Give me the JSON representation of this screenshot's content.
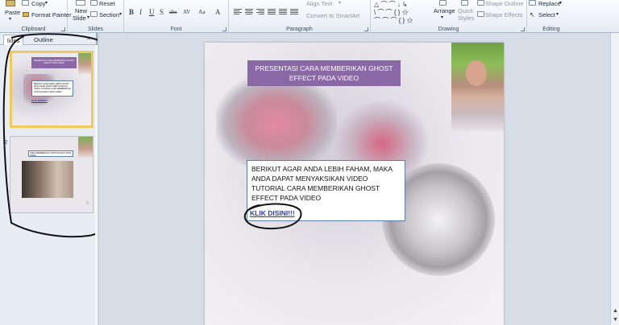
{
  "ribbon": {
    "clipboard": {
      "label": "Clipboard",
      "paste": "Paste",
      "copy": "Copy",
      "format_painter": "Format Painter"
    },
    "slides": {
      "label": "Slides",
      "new_slide_1": "New",
      "new_slide_2": "Slide",
      "reset": "Reset",
      "section": "Section"
    },
    "font": {
      "label": "Font",
      "bold": "B",
      "italic": "I",
      "underline": "U",
      "shadow": "S",
      "strike": "abc",
      "spacing": "AV",
      "case": "Aa",
      "color": "A"
    },
    "paragraph": {
      "label": "Paragraph",
      "align_text": "Align Text",
      "convert_smartart": "Convert to SmartArt"
    },
    "drawing": {
      "label": "Drawing",
      "arrange": "Arrange",
      "quick_styles_1": "Quick",
      "quick_styles_2": "Styles",
      "shape_outline": "Shape Outline",
      "shape_effects": "Shape Effects"
    },
    "editing": {
      "label": "Editing",
      "replace": "Replace",
      "select": "Select"
    }
  },
  "pane": {
    "tabs": [
      {
        "label": "lides"
      },
      {
        "label": "Outline"
      }
    ],
    "thumb1": {
      "title": "PRESENTASI CARA MEMBERIKAN GHOST EFFECT PADA VIDEO",
      "body": "BERIKUT AGAR ANDA LEBIH FAHAM, MAKA ANDA DAPAT MENYAKSIKAN VIDEO TUTORIAL CARA MEMBERIKAN GHOST EFFECT PADA VIDEO",
      "link": "KLIK DISINI!!!"
    },
    "thumb2": {
      "number": "2",
      "title": "CARA MEMBERIKAN GHOST EFFECT PADA VIDEO"
    }
  },
  "slide": {
    "title": "PRESENTASI CARA MEMBERIKAN GHOST EFFECT PADA VIDEO",
    "body": "BERIKUT AGAR ANDA LEBIH FAHAM, MAKA ANDA DAPAT MENYAKSIKAN VIDEO TUTORIAL CARA MEMBERIKAN GHOST EFFECT PADA VIDEO",
    "link": "KLIK DISINI!!!"
  },
  "colors": {
    "title_fill": "#8a68a6",
    "link": "#2b3fb3",
    "selected_border": "#f0c95a"
  }
}
